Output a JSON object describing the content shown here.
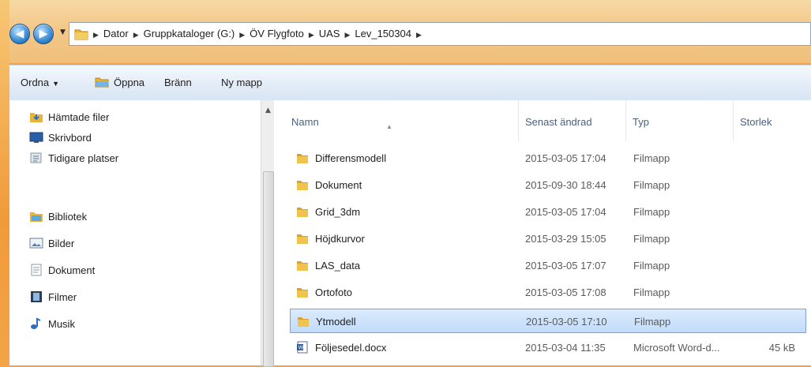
{
  "breadcrumb": [
    "Dator",
    "Gruppkataloger (G:)",
    "ÖV Flygfoto",
    "UAS",
    "Lev_150304"
  ],
  "toolbar": {
    "organize": "Ordna",
    "open": "Öppna",
    "burn": "Bränn",
    "new_folder": "Ny mapp"
  },
  "nav": {
    "items": [
      {
        "label": "Hämtade filer",
        "icon": "downloads-icon"
      },
      {
        "label": "Skrivbord",
        "icon": "desktop-icon"
      },
      {
        "label": "Tidigare platser",
        "icon": "recent-places-icon"
      },
      {
        "label": "Bibliotek",
        "icon": "libraries-icon"
      },
      {
        "label": "Bilder",
        "icon": "pictures-icon"
      },
      {
        "label": "Dokument",
        "icon": "documents-icon"
      },
      {
        "label": "Filmer",
        "icon": "videos-icon"
      },
      {
        "label": "Musik",
        "icon": "music-icon"
      }
    ]
  },
  "columns": {
    "name": "Namn",
    "modified": "Senast ändrad",
    "type": "Typ",
    "size": "Storlek"
  },
  "files": [
    {
      "name": "Differensmodell",
      "modified": "2015-03-05 17:04",
      "type": "Filmapp",
      "size": "",
      "kind": "folder"
    },
    {
      "name": "Dokument",
      "modified": "2015-09-30 18:44",
      "type": "Filmapp",
      "size": "",
      "kind": "folder"
    },
    {
      "name": "Grid_3dm",
      "modified": "2015-03-05 17:04",
      "type": "Filmapp",
      "size": "",
      "kind": "folder"
    },
    {
      "name": "Höjdkurvor",
      "modified": "2015-03-29 15:05",
      "type": "Filmapp",
      "size": "",
      "kind": "folder"
    },
    {
      "name": "LAS_data",
      "modified": "2015-03-05 17:07",
      "type": "Filmapp",
      "size": "",
      "kind": "folder"
    },
    {
      "name": "Ortofoto",
      "modified": "2015-03-05 17:08",
      "type": "Filmapp",
      "size": "",
      "kind": "folder"
    },
    {
      "name": "Ytmodell",
      "modified": "2015-03-05 17:10",
      "type": "Filmapp",
      "size": "",
      "kind": "folder",
      "selected": true
    },
    {
      "name": "Följesedel.docx",
      "modified": "2015-03-04 11:35",
      "type": "Microsoft Word-d...",
      "size": "45 kB",
      "kind": "word"
    }
  ],
  "colors": {
    "folder": "#e8b43a",
    "selection": "#cce4fb",
    "accent": "#3d8fd6"
  }
}
